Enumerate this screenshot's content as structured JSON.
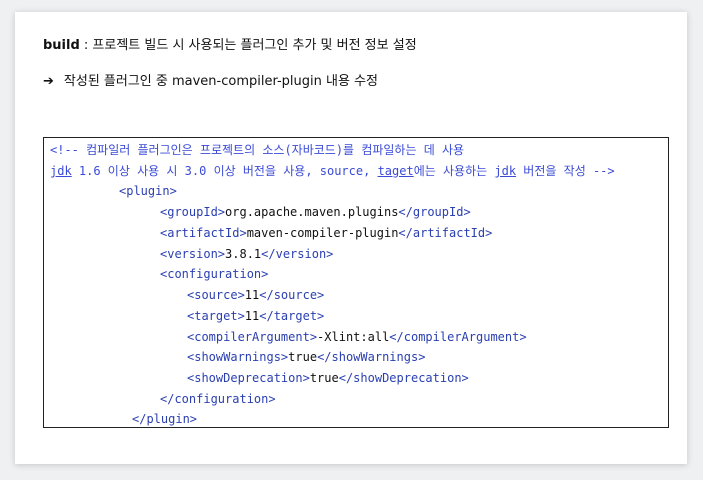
{
  "intro": {
    "keyword": "build",
    "description": " : 프로젝트 빌드 시 사용되는 플러그인 추가 및 버전 정보 설정",
    "arrow": "➔",
    "note": "작성된 플러그인 중 maven-compiler-plugin 내용 수정"
  },
  "code": {
    "comment_line1": "<!-- 컴파일러 플러그인은 프로젝트의 소스(자바코드)를 컴파일하는 데 사용",
    "comment2_jdk": "jdk",
    "comment2_a": " 1.6 이상 사용 시 3.0 이상 버전을 사용, source, ",
    "comment2_taget": "taget",
    "comment2_b": "에는 사용하는 ",
    "comment2_jdk2": "jdk",
    "comment2_c": " 버전을 작성 -->",
    "plugin_open": "<plugin>",
    "groupId_open": "<groupId>",
    "groupId_value": "org.apache.maven.plugins",
    "groupId_close": "</groupId>",
    "artifactId_open": "<artifactId>",
    "artifactId_value": "maven-compiler-plugin",
    "artifactId_close": "</artifactId>",
    "version_open": "<version>",
    "version_value": "3.8.1",
    "version_close": "</version>",
    "configuration_open": "<configuration>",
    "source_open": "<source>",
    "source_value": "11",
    "source_close": "</source>",
    "target_open": "<target>",
    "target_value": "11",
    "target_close": "</target>",
    "compilerArgument_open": "<compilerArgument>",
    "compilerArgument_value": "-Xlint:all",
    "compilerArgument_close": "</compilerArgument>",
    "showWarnings_open": "<showWarnings>",
    "showWarnings_value": "true",
    "showWarnings_close": "</showWarnings>",
    "showDeprecation_open": "<showDeprecation>",
    "showDeprecation_value": "true",
    "showDeprecation_close": "</showDeprecation>",
    "configuration_close": "</configuration>",
    "plugin_close": "</plugin>"
  }
}
